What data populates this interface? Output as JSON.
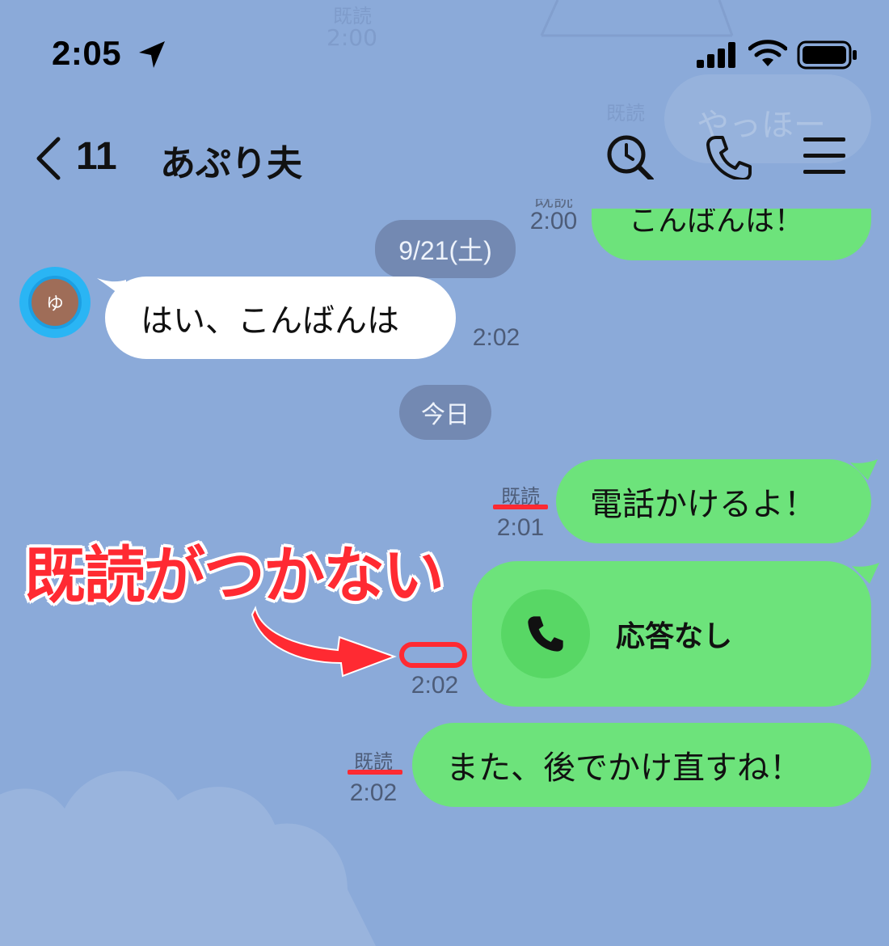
{
  "status_bar": {
    "time": "2:05"
  },
  "header": {
    "back_count": "11",
    "title": "あぷり夫"
  },
  "background_ghost": {
    "read": "既読",
    "time1": "2:00",
    "bubble1": "やっほー",
    "bubble2": "こんばんは！",
    "read2": "既読",
    "time2": "2:00"
  },
  "date_chips": {
    "date": "9/21(土)",
    "today": "今日"
  },
  "avatar": {
    "initial": "ゆ"
  },
  "messages": [
    {
      "side": "left",
      "text": "はい、こんばんは",
      "time": "2:02"
    },
    {
      "side": "right",
      "text": "電話かけるよ！",
      "read": "既読",
      "time": "2:01"
    },
    {
      "side": "right",
      "type": "call",
      "text": "応答なし",
      "time": "2:02"
    },
    {
      "side": "right",
      "text": "また、後でかけ直すね！",
      "read": "既読",
      "time": "2:02"
    }
  ],
  "annotation": {
    "text": "既読がつかない"
  },
  "colors": {
    "background": "#8baad9",
    "bubble_green": "#6de37b",
    "annotation_red": "#ff2a32",
    "chip": "#7389b2"
  }
}
